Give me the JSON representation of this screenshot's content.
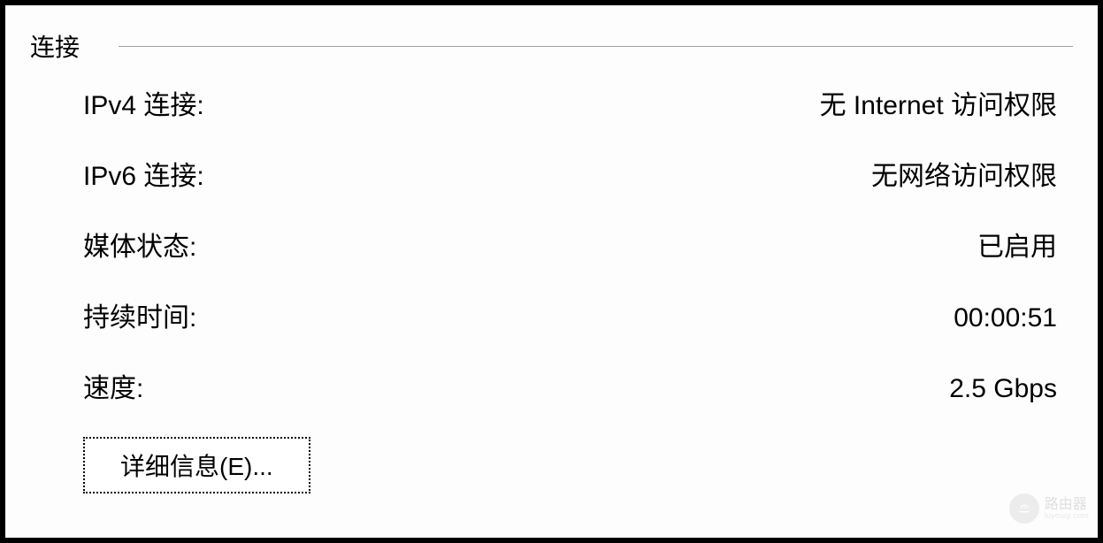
{
  "connection": {
    "legend": "连接",
    "rows": [
      {
        "label": "IPv4 连接:",
        "value": "无 Internet 访问权限"
      },
      {
        "label": "IPv6 连接:",
        "value": "无网络访问权限"
      },
      {
        "label": "媒体状态:",
        "value": "已启用"
      },
      {
        "label": "持续时间:",
        "value": "00:00:51"
      },
      {
        "label": "速度:",
        "value": "2.5 Gbps"
      }
    ],
    "details_button": "详细信息(E)..."
  },
  "watermark": {
    "main": "路由器",
    "sub": "luyouqi.com"
  }
}
